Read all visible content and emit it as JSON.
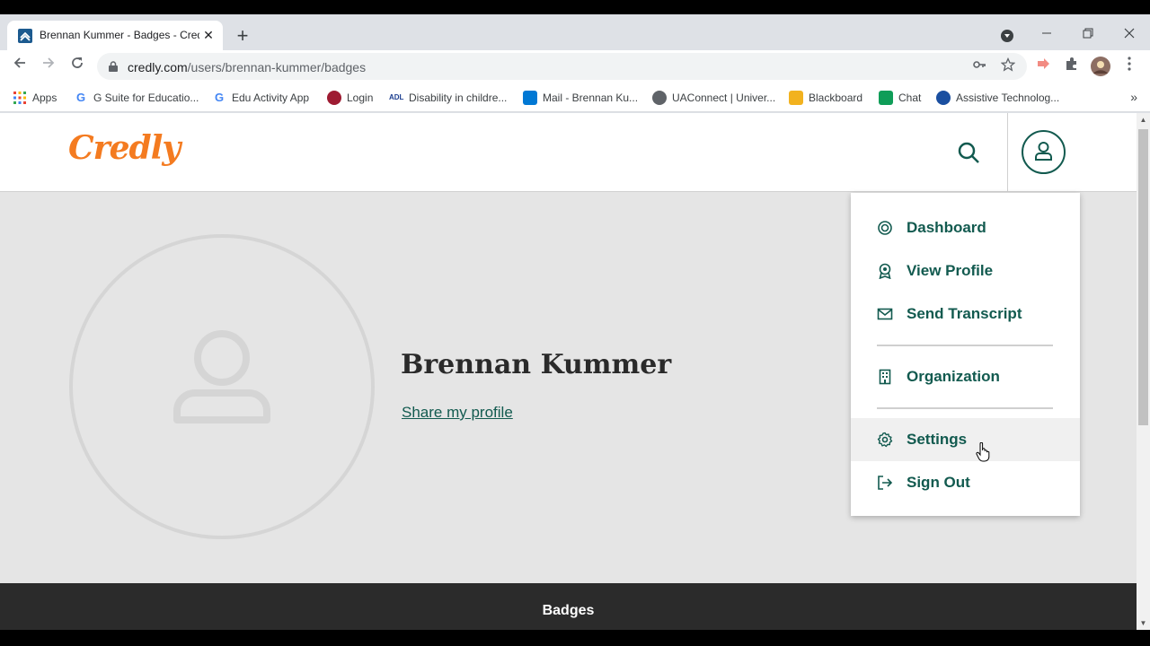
{
  "browser": {
    "tab_title": "Brennan Kummer - Badges - Credly",
    "tab_close": "✕",
    "new_tab": "+",
    "url_domain": "credly.com",
    "url_path": "/users/brennan-kummer/badges",
    "bookmarks": [
      {
        "label": "Apps",
        "icon": "apps-grid-icon",
        "color": "#ea4335"
      },
      {
        "label": "G Suite for Educatio...",
        "icon": "google-icon",
        "color": "#4285f4"
      },
      {
        "label": "Edu Activity App",
        "icon": "google-icon",
        "color": "#4285f4"
      },
      {
        "label": "Login",
        "icon": "shield-icon",
        "color": "#9e1b32"
      },
      {
        "label": "Disability in childre...",
        "icon": "adl-icon",
        "color": "#1a3d8f"
      },
      {
        "label": "Mail - Brennan Ku...",
        "icon": "outlook-icon",
        "color": "#0078d4"
      },
      {
        "label": "UAConnect | Univer...",
        "icon": "globe-icon",
        "color": "#5f6368"
      },
      {
        "label": "Blackboard",
        "icon": "blackboard-icon",
        "color": "#f2b21f"
      },
      {
        "label": "Chat",
        "icon": "chat-icon",
        "color": "#0f9d58"
      },
      {
        "label": "Assistive Technolog...",
        "icon": "assistive-tech-icon",
        "color": "#1a4fa0"
      }
    ],
    "bookmarks_more": "»"
  },
  "site": {
    "logo": "Credly",
    "brand_color": "#f47b20",
    "accent_color": "#125a4f",
    "profile_name": "Brennan Kummer",
    "share_link": "Share my profile",
    "badges_tab": "Badges"
  },
  "menu": {
    "items": [
      {
        "label": "Dashboard",
        "icon": "dashboard-icon"
      },
      {
        "label": "View Profile",
        "icon": "badge-profile-icon"
      },
      {
        "label": "Send Transcript",
        "icon": "envelope-icon"
      },
      {
        "label": "Organization",
        "icon": "building-icon"
      },
      {
        "label": "Settings",
        "icon": "gear-icon"
      },
      {
        "label": "Sign Out",
        "icon": "sign-out-icon"
      }
    ]
  }
}
